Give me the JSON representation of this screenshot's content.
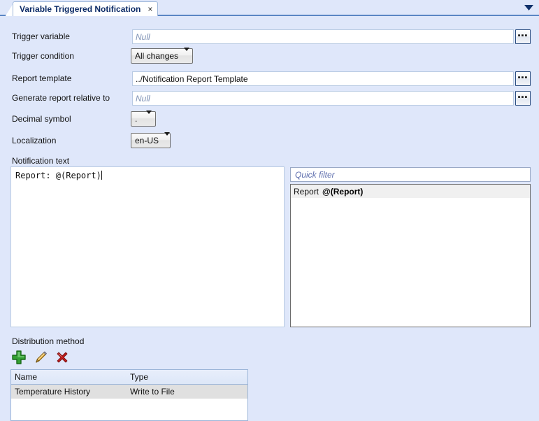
{
  "window": {
    "tab_title": "Variable Triggered Notification",
    "tab_close": "×",
    "menu_icon": "chevron-down-icon"
  },
  "form": {
    "fields": [
      {
        "label": "Trigger variable",
        "value": "",
        "placeholder": "Null"
      },
      {
        "label": "Trigger condition",
        "value": "All changes"
      },
      {
        "label": "Report template",
        "value": "../Notification Report Template",
        "placeholder": "Null"
      },
      {
        "label": "Generate report relative to",
        "value": "",
        "placeholder": "Null"
      },
      {
        "label": "Decimal symbol",
        "value": "."
      },
      {
        "label": "Localization",
        "value": "en-US"
      }
    ],
    "browse_label": "▪▪▪"
  },
  "notification": {
    "label": "Notification text",
    "text": "Report: @(Report)"
  },
  "tokens": {
    "filter_placeholder": "Quick filter",
    "items": [
      {
        "name": "Report",
        "token": "@(Report)"
      }
    ]
  },
  "distribution": {
    "label": "Distribution method",
    "toolbar": [
      {
        "icon": "add-icon",
        "title": "Add"
      },
      {
        "icon": "edit-icon",
        "title": "Edit"
      },
      {
        "icon": "delete-icon",
        "title": "Delete"
      }
    ],
    "columns": [
      "Name",
      "Type"
    ],
    "rows": [
      {
        "name": "Temperature History",
        "type": "Write to File"
      }
    ]
  },
  "colors": {
    "background": "#dfe7fa",
    "tab_text": "#0b2a66",
    "placeholder": "#7f92b5",
    "accent_line": "#5b86c4",
    "add_green": "#2e9b2e",
    "edit_orange": "#e8a33d",
    "delete_red": "#cc2222"
  }
}
